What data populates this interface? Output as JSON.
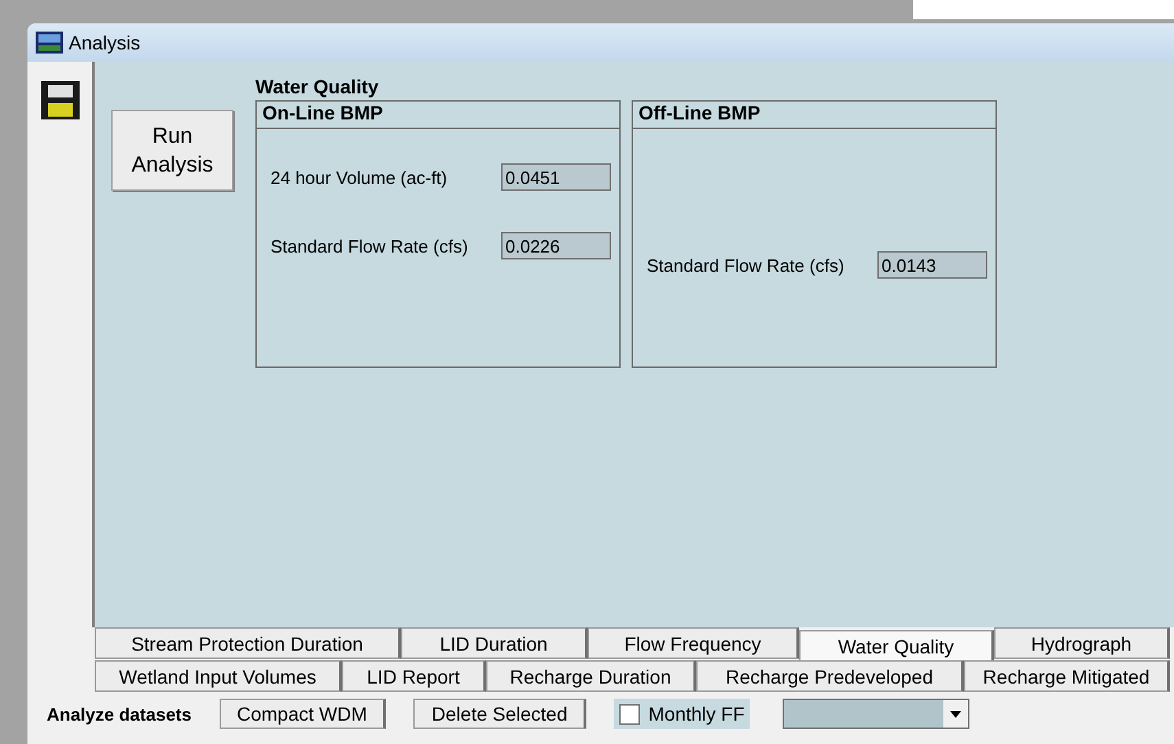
{
  "window": {
    "title": "Analysis"
  },
  "run_button": "Run\nAnalysis",
  "section_title": "Water Quality",
  "groups": [
    {
      "title": "On-Line BMP",
      "fields": [
        {
          "label": "24 hour Volume (ac-ft)",
          "value": "0.0451"
        },
        {
          "label": "Standard Flow Rate  (cfs)",
          "value": "0.0226"
        }
      ]
    },
    {
      "title": "Off-Line BMP",
      "fields": [
        {
          "label": "Standard Flow Rate  (cfs)",
          "value": "0.0143"
        }
      ]
    }
  ],
  "tab_rows": [
    [
      {
        "label": "Stream Protection Duration",
        "selected": false
      },
      {
        "label": "LID Duration",
        "selected": false
      },
      {
        "label": "Flow Frequency",
        "selected": false
      },
      {
        "label": "Water Quality",
        "selected": true
      },
      {
        "label": "Hydrograph",
        "selected": false
      }
    ],
    [
      {
        "label": "Wetland Input Volumes",
        "selected": false
      },
      {
        "label": "LID Report",
        "selected": false
      },
      {
        "label": "Recharge Duration",
        "selected": false
      },
      {
        "label": "Recharge Predeveloped",
        "selected": false
      },
      {
        "label": "Recharge Mitigated",
        "selected": false
      }
    ]
  ],
  "bottom": {
    "label": "Analyze datasets",
    "buttons": [
      "Compact WDM",
      "Delete Selected"
    ],
    "checkbox": {
      "label": "Monthly FF",
      "checked": false
    }
  }
}
